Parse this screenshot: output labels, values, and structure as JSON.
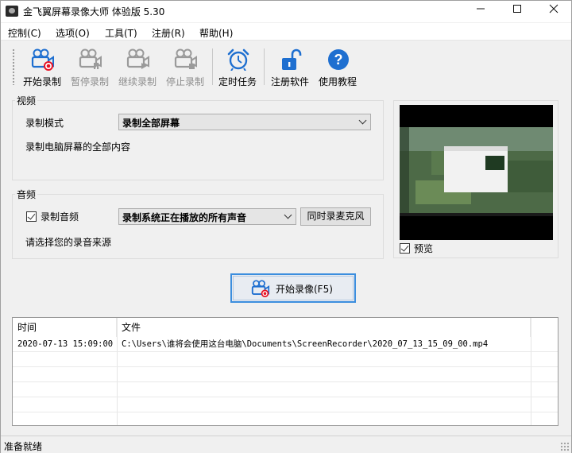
{
  "window": {
    "title": "金飞翼屏幕录像大师 体验版 5.30"
  },
  "menu": [
    "控制(C)",
    "选项(O)",
    "工具(T)",
    "注册(R)",
    "帮助(H)"
  ],
  "toolbar": {
    "start": "开始录制",
    "pause": "暂停录制",
    "resume": "继续录制",
    "stop": "停止录制",
    "schedule": "定时任务",
    "register": "注册软件",
    "help": "使用教程"
  },
  "video": {
    "group_title": "视频",
    "mode_label": "录制模式",
    "mode_value": "录制全部屏幕",
    "mode_desc": "录制电脑屏幕的全部内容"
  },
  "audio": {
    "group_title": "音频",
    "record_audio_label": "录制音频",
    "record_audio_checked": true,
    "source_value": "录制系统正在播放的所有声音",
    "mic_button": "同时录麦克风",
    "source_desc": "请选择您的录音来源"
  },
  "preview": {
    "label": "预览",
    "checked": true
  },
  "main_button": "开始录像(F5)",
  "table": {
    "headers": [
      "时间",
      "文件"
    ],
    "rows": [
      [
        "2020-07-13 15:09:00",
        "C:\\Users\\谁将会使用这台电脑\\Documents\\ScreenRecorder\\2020_07_13_15_09_00.mp4"
      ]
    ]
  },
  "status": "准备就绪",
  "colors": {
    "accent": "#0078d7",
    "record_red": "#e81123",
    "disabled": "#8c8c8c"
  }
}
